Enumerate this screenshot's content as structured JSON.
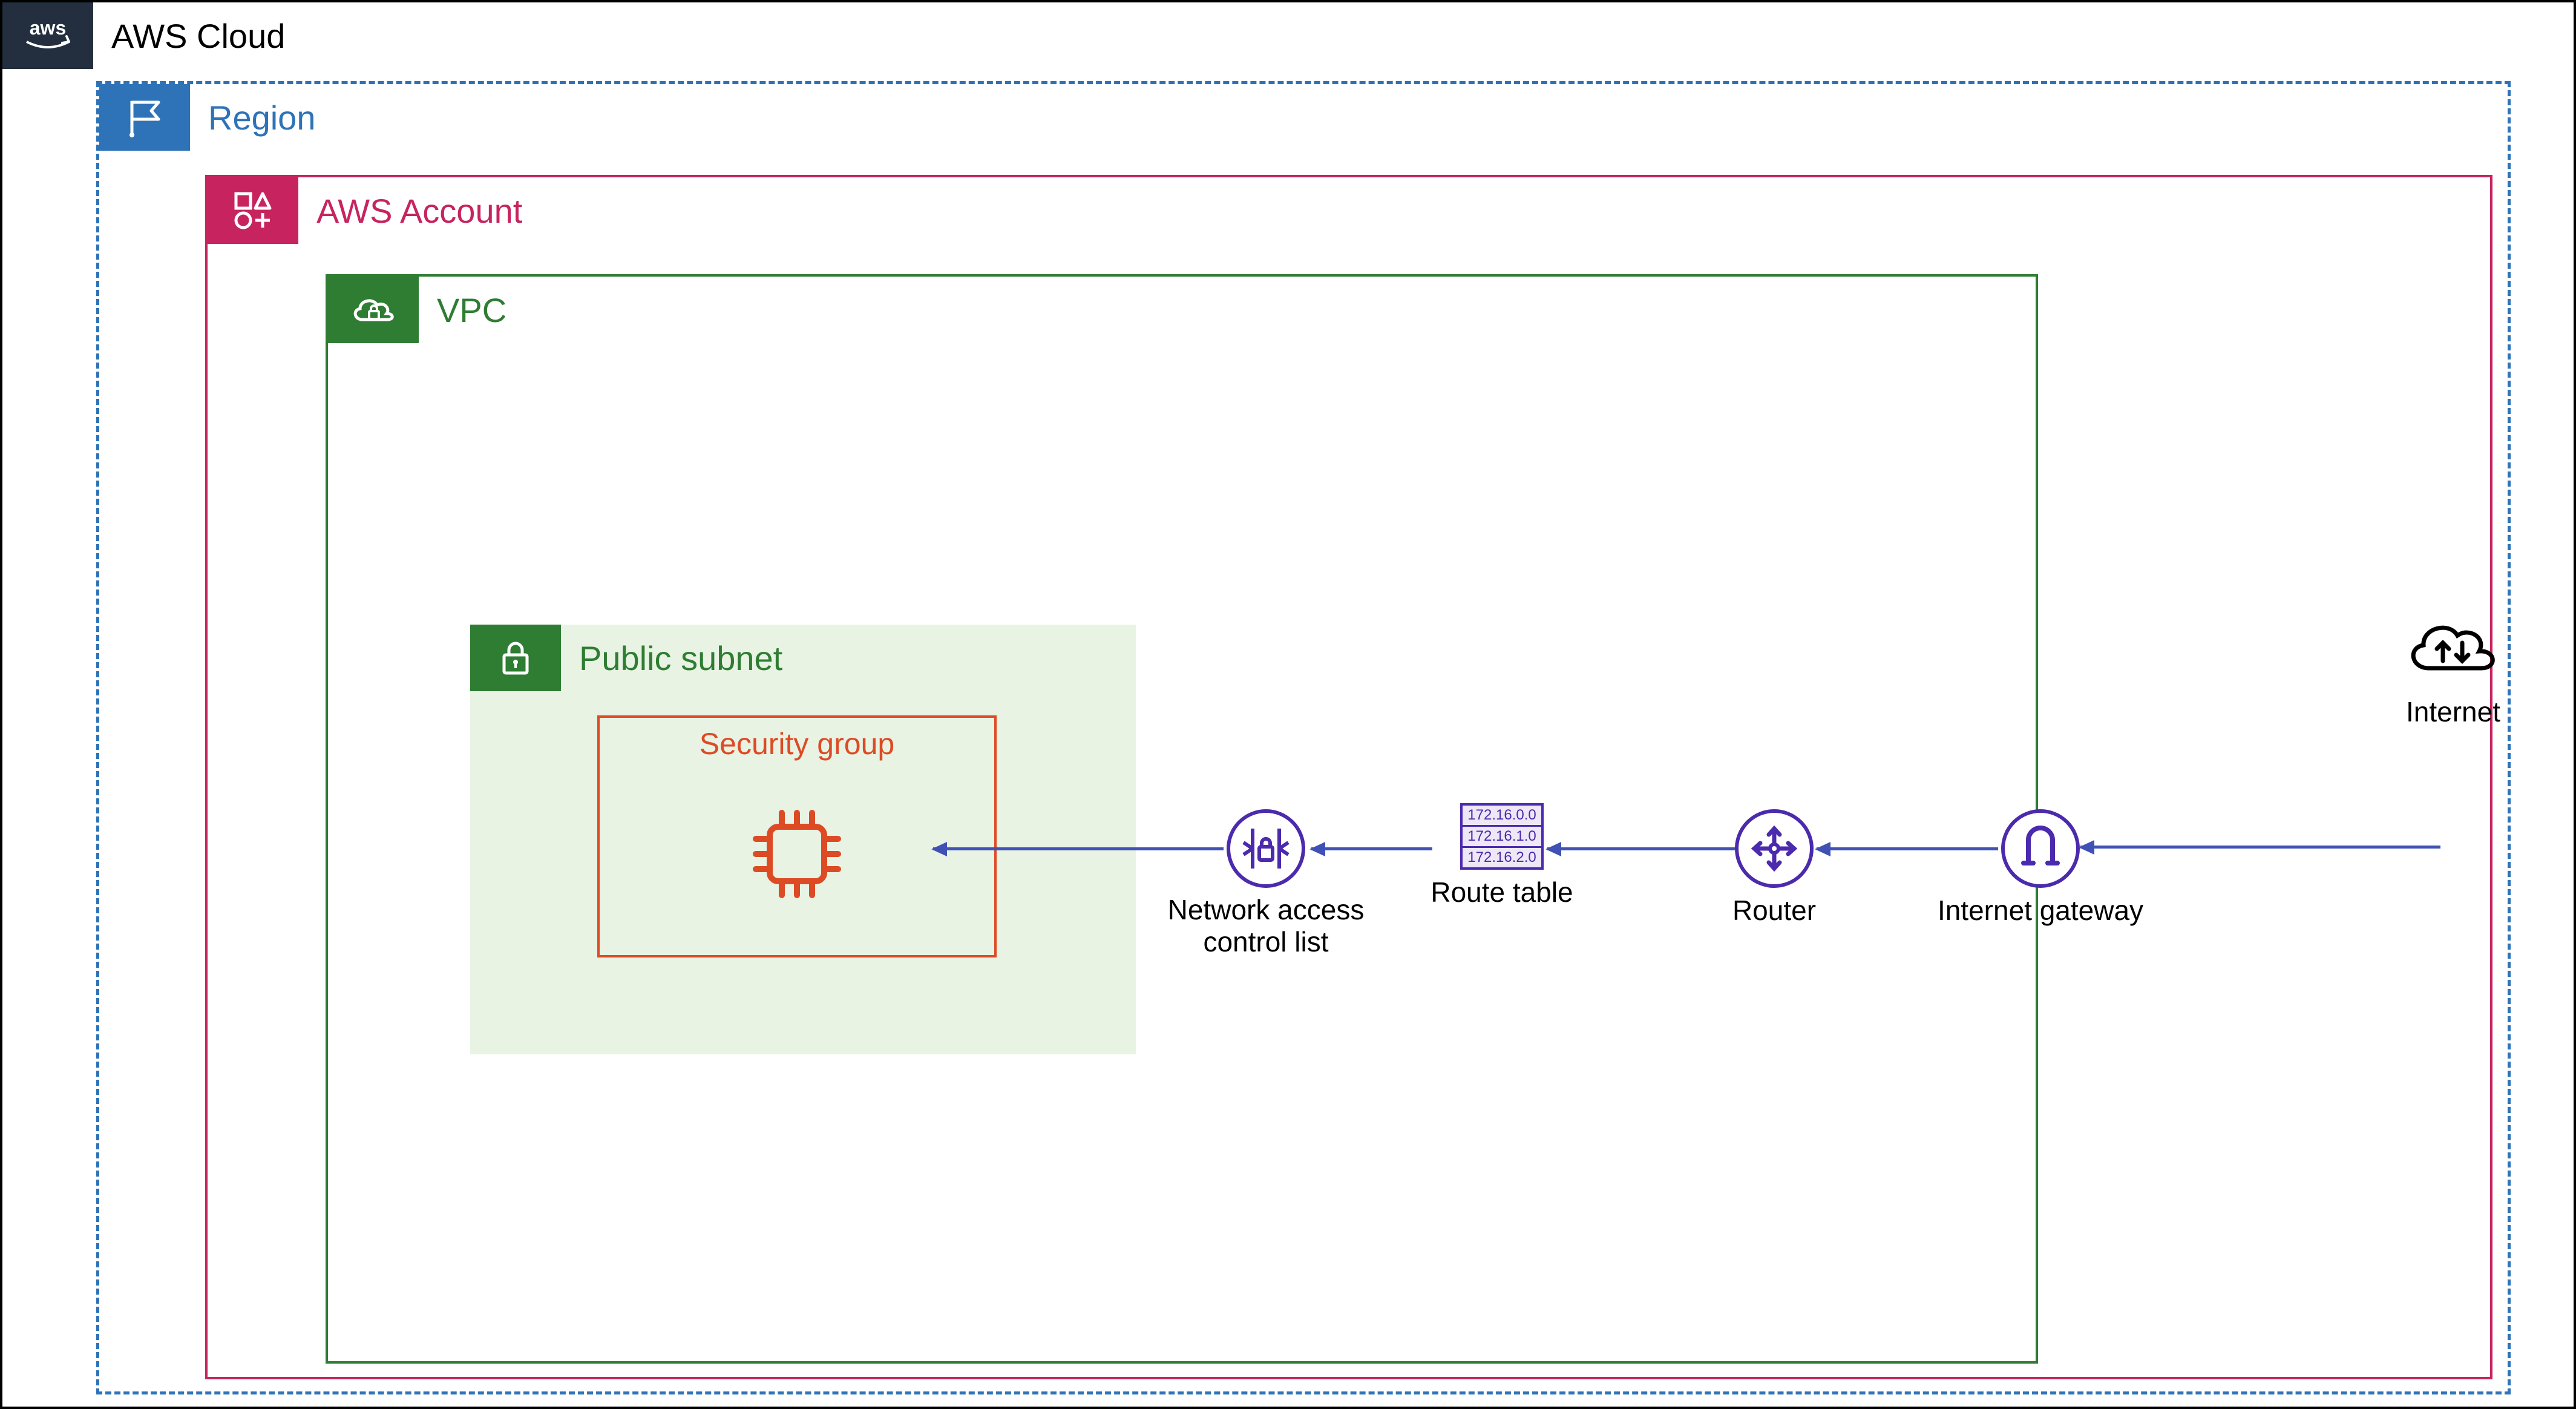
{
  "cloud": {
    "label": "AWS Cloud"
  },
  "region": {
    "label": "Region"
  },
  "account": {
    "label": "AWS Account"
  },
  "vpc": {
    "label": "VPC"
  },
  "subnet": {
    "label": "Public subnet"
  },
  "security_group": {
    "label": "Security group"
  },
  "nodes": {
    "nacl": {
      "label_line1": "Network access",
      "label_line2": "control list"
    },
    "route_table": {
      "label": "Route table",
      "rows": [
        "172.16.0.0",
        "172.16.1.0",
        "172.16.2.0"
      ]
    },
    "router": {
      "label": "Router"
    },
    "igw": {
      "label": "Internet gateway"
    },
    "internet": {
      "label": "Internet"
    }
  }
}
